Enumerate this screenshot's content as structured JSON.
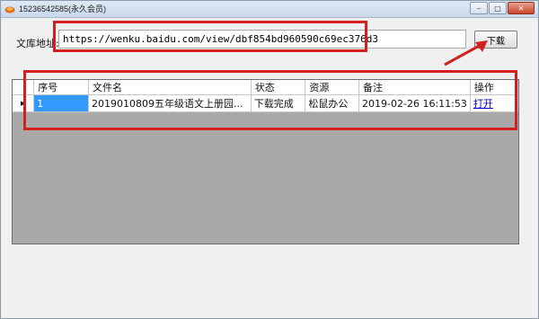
{
  "window": {
    "title": "15236542585(永久会员)",
    "controls": {
      "minimize": "–",
      "maximize": "□",
      "close": "✕"
    }
  },
  "url_row": {
    "label": "文库地址:",
    "value": "https://wenku.baidu.com/view/dbf854bd960590c69ec376d3",
    "download_label": "下载"
  },
  "grid": {
    "columns": [
      "序号",
      "文件名",
      "状态",
      "资源",
      "备注",
      "操作"
    ],
    "rows": [
      {
        "index": "1",
        "filename": "2019010809五年级语文上册园...",
        "status": "下载完成",
        "source": "松鼠办公",
        "note": "2019-02-26 16:11:53",
        "action": "打开"
      }
    ]
  },
  "colors": {
    "highlight": "#d21f1f",
    "selection": "#3399ff",
    "grid_empty": "#a9a9a9"
  }
}
